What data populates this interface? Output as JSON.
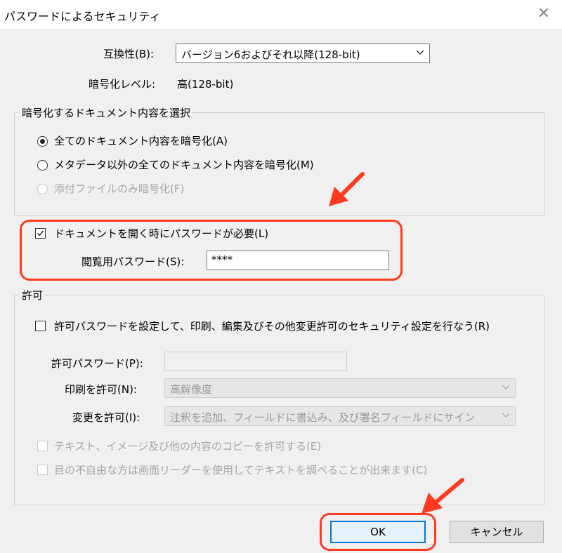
{
  "window": {
    "title": "パスワードによるセキュリティ",
    "close_glyph": "✕"
  },
  "compat": {
    "label": "互換性(B):",
    "value": "バージョン6およびそれ以降(128-bit)"
  },
  "encryption_level": {
    "label": "暗号化レベル:",
    "value": "高(128-bit)"
  },
  "encrypt_group": {
    "title": "暗号化するドキュメント内容を選択",
    "options": [
      {
        "label": "全てのドキュメント内容を暗号化(A)",
        "selected": true,
        "enabled": true
      },
      {
        "label": "メタデータ以外の全てのドキュメント内容を暗号化(M)",
        "selected": false,
        "enabled": true
      },
      {
        "label": "添付ファイルのみ暗号化(F)",
        "selected": false,
        "enabled": false
      }
    ]
  },
  "open_password": {
    "checkbox_label": "ドキュメントを開く時にパスワードが必要(L)",
    "checked": true,
    "field_label": "閲覧用パスワード(S):",
    "field_value": "****"
  },
  "permissions": {
    "title": "許可",
    "checkbox_label": "許可パスワードを設定して、印刷、編集及びその他変更許可のセキュリティ設定を行なう(R)",
    "checked": false,
    "password_label": "許可パスワード(P):",
    "password_value": "",
    "print_label": "印刷を許可(N):",
    "print_value": "高解像度",
    "change_label": "変更を許可(I):",
    "change_value": "注釈を追加、フィールドに書込み、及び署名フィールドにサイン",
    "copy_label": "テキスト、イメージ及び他の内容のコピーを許可する(E)",
    "screenreader_label": "目の不自由な方は画面リーダーを使用してテキストを調べることが出来ます(C)"
  },
  "buttons": {
    "ok": "OK",
    "cancel": "キャンセル"
  },
  "colors": {
    "highlight": "#ff3b1f",
    "accent": "#0078d7",
    "disabled_text": "#a6a6a6"
  }
}
